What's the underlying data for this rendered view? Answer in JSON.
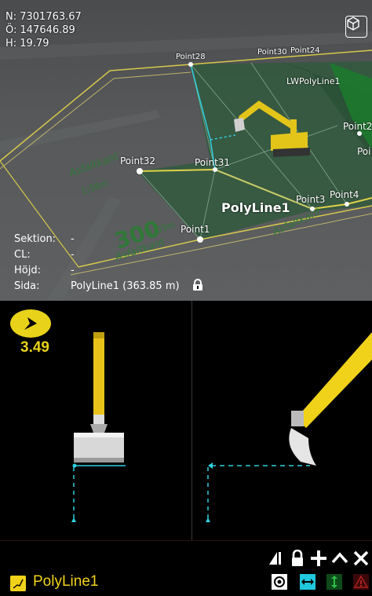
{
  "map": {
    "coords": {
      "north": "N: 7301763.67",
      "east": "Ö: 147646.89",
      "height": "H: 19.79"
    },
    "points": {
      "p28": "Point28",
      "p30": "Point30",
      "p24": "Point24",
      "lwpolyline": "LWPolyLine1",
      "p2": "Point2",
      "poi": "Poi",
      "p32": "Point32",
      "p31": "Point31",
      "polyline_big": "PolyLine1",
      "p3": "Point3",
      "p4": "Point4",
      "p1": "Point1"
    },
    "ground_text": {
      "asfaltkant1": "Asfaltkant",
      "asfaltkant2": "Asfaltkant",
      "asfaltkant3": "Asfaltkant",
      "num300": "300",
      "num_a": "1/03m",
      "num_b": "1/38m"
    },
    "info": {
      "sektion_label": "Sektion:",
      "sektion_value": "-",
      "cl_label": "CL:",
      "cl_value": "-",
      "hojd_label": "Höjd:",
      "hojd_value": "-",
      "sida_label": "Sida:",
      "sida_value": "PolyLine1 (363.85 m)"
    },
    "view_cube_icon": "cube-icon"
  },
  "guidance": {
    "cut_value": "3.49",
    "compass_icon": "arrow-up-right-icon"
  },
  "toolbar": {
    "icons": [
      "offset-icon",
      "lock-icon",
      "plus-icon",
      "chevron-up-icon",
      "close-icon"
    ],
    "toggles": [
      "eye-icon",
      "horizontal-arrows-icon",
      "vertical-arrows-icon",
      "warning-icon"
    ]
  },
  "active_line": {
    "name": "PolyLine1",
    "color": "#f0d21a"
  },
  "colors": {
    "accent_yellow": "#e8d21a",
    "cyan": "#2fd0e0",
    "surface_green": "#2f5a3c"
  }
}
